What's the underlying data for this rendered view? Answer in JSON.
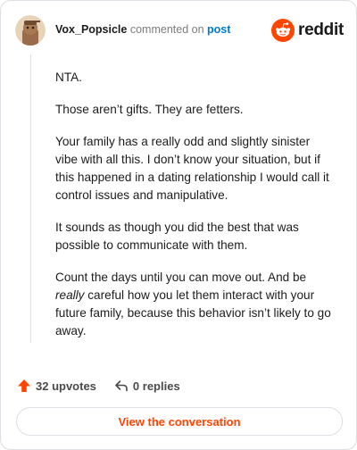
{
  "comment": {
    "username": "Vox_Popsicle",
    "action_text": "commented on",
    "post_link_label": "post",
    "paragraphs": [
      "NTA.",
      "Those aren’t gifts. They are fetters.",
      "Your family has a really odd and slightly sinister vibe with all this. I don’t know your situation, but if this happened in a dating relationship I would call it control issues and manipulative.",
      "It sounds as though you did the best that was possible to communicate with them."
    ],
    "last_paragraph": {
      "before": "Count the days until you can move out. And be ",
      "emphasis": "really",
      "after": " careful how you let them interact with your future family, because this behavior isn’t likely to go away."
    }
  },
  "brand": {
    "wordmark": "reddit",
    "logo_icon": "reddit-snoo-icon",
    "accent": "#ff4500"
  },
  "footer": {
    "upvotes_label": "32 upvotes",
    "upvote_icon": "upvote-arrow-icon",
    "replies_label": "0 replies",
    "reply_icon": "reply-arrow-icon",
    "view_button_label": "View the conversation"
  }
}
